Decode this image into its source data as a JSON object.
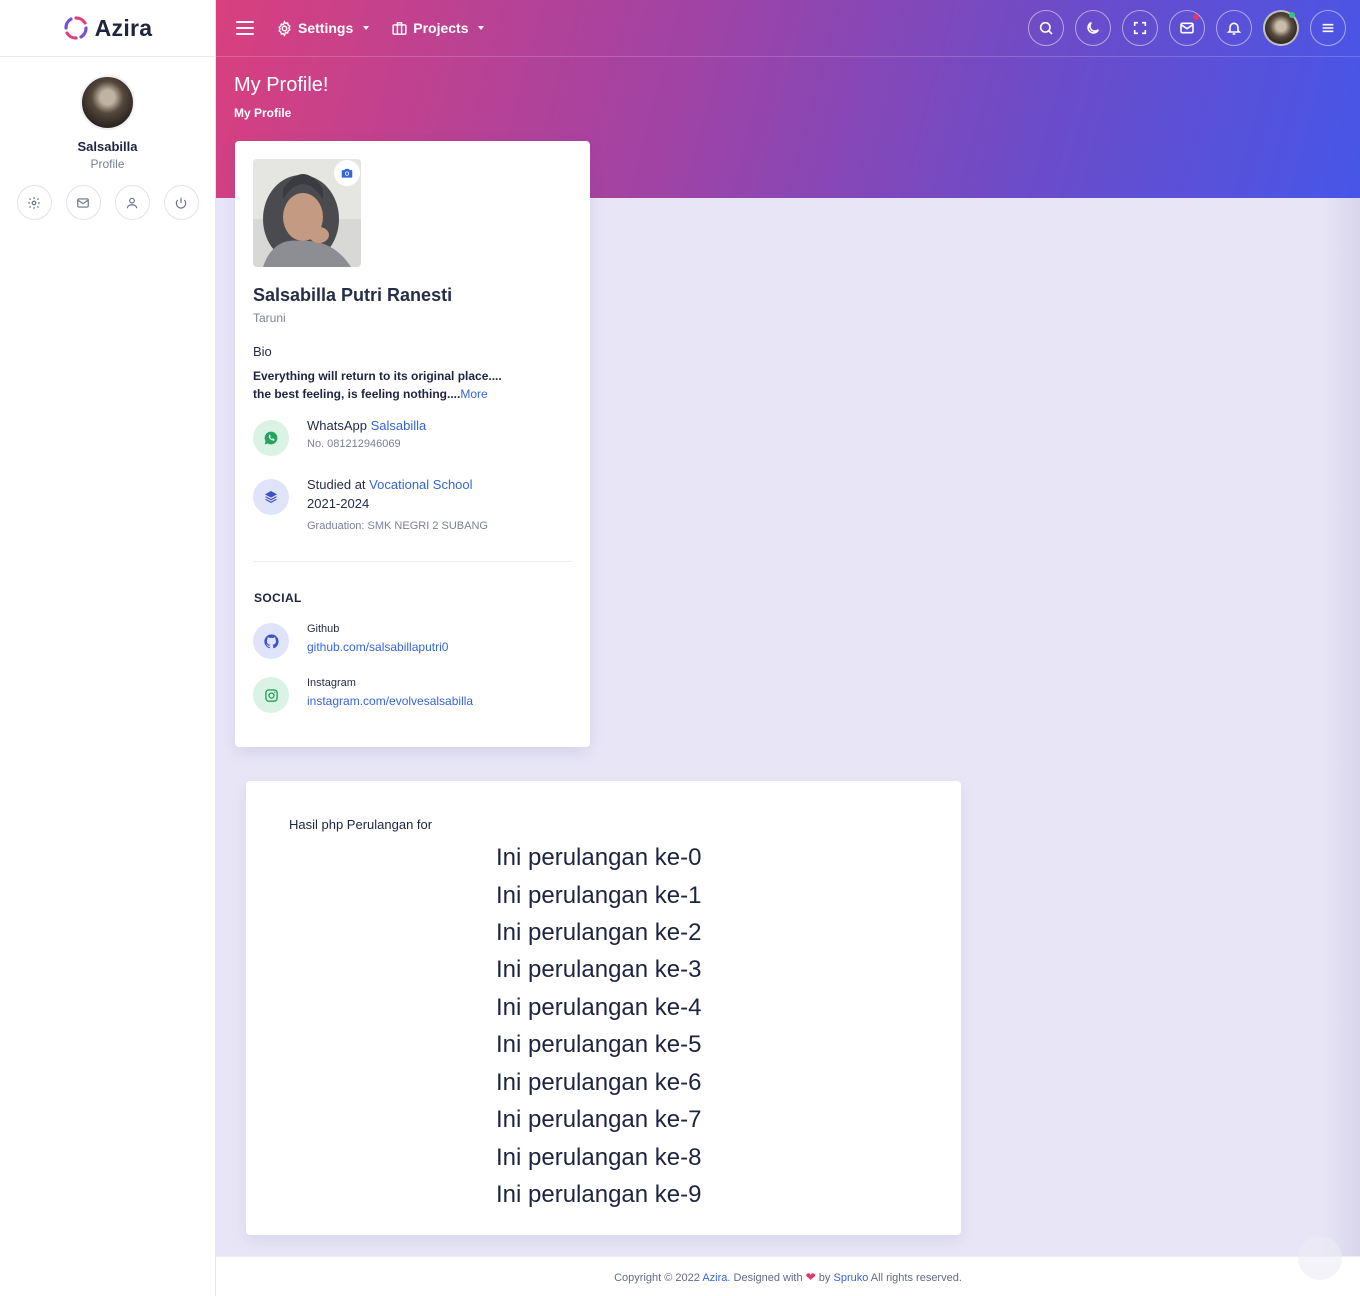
{
  "app": {
    "name": "Azira"
  },
  "sidebar": {
    "user_name": "Salsabilla",
    "user_role": "Profile"
  },
  "topbar": {
    "menus": [
      "Settings",
      "Projects"
    ]
  },
  "page": {
    "title": "My Profile!",
    "breadcrumb": "My Profile"
  },
  "profile": {
    "name": "Salsabilla Putri Ranesti",
    "role": "Taruni",
    "bio_heading": "Bio",
    "bio_line1": "Everything will return to its original place....",
    "bio_line2": "the best feeling, is feeling nothing....",
    "bio_more": "More",
    "whatsapp_label": "WhatsApp",
    "whatsapp_name": "Salsabilla",
    "whatsapp_number": "No. 081212946069",
    "studied_prefix": "Studied at",
    "studied_school": "Vocational School",
    "studied_years": "2021-2024",
    "graduation": "Graduation: SMK NEGRI 2 SUBANG",
    "social_heading": "SOCIAL",
    "github_label": "Github",
    "github_link": "github.com/salsabillaputri0",
    "instagram_label": "Instagram",
    "instagram_link": "instagram.com/evolvesalsabilla"
  },
  "loop_card": {
    "title": "Hasil php Perulangan for",
    "items": [
      "Ini perulangan ke-0",
      "Ini perulangan ke-1",
      "Ini perulangan ke-2",
      "Ini perulangan ke-3",
      "Ini perulangan ke-4",
      "Ini perulangan ke-5",
      "Ini perulangan ke-6",
      "Ini perulangan ke-7",
      "Ini perulangan ke-8",
      "Ini perulangan ke-9"
    ]
  },
  "footer": {
    "prefix": "Copyright © 2022",
    "brand": "Azira",
    "designed": ". Designed with",
    "by": "by",
    "company": "Spruko",
    "rights": "All rights reserved."
  },
  "colors": {
    "accent": "#3565db",
    "gradient_start": "#d9407e",
    "gradient_end": "#4756e8",
    "whatsapp": "#25a35f",
    "notify_dot": "#e8336b",
    "online_dot": "#35c47c"
  },
  "icons": [
    "azira-logo-icon",
    "settings-icon",
    "mail-icon",
    "user-icon",
    "power-icon",
    "menu-icon",
    "gear-icon",
    "briefcase-icon",
    "search-icon",
    "moon-icon",
    "fullscreen-icon",
    "bell-icon",
    "camera-icon",
    "whatsapp-icon",
    "layers-icon",
    "github-icon",
    "instagram-icon",
    "heart-icon"
  ]
}
